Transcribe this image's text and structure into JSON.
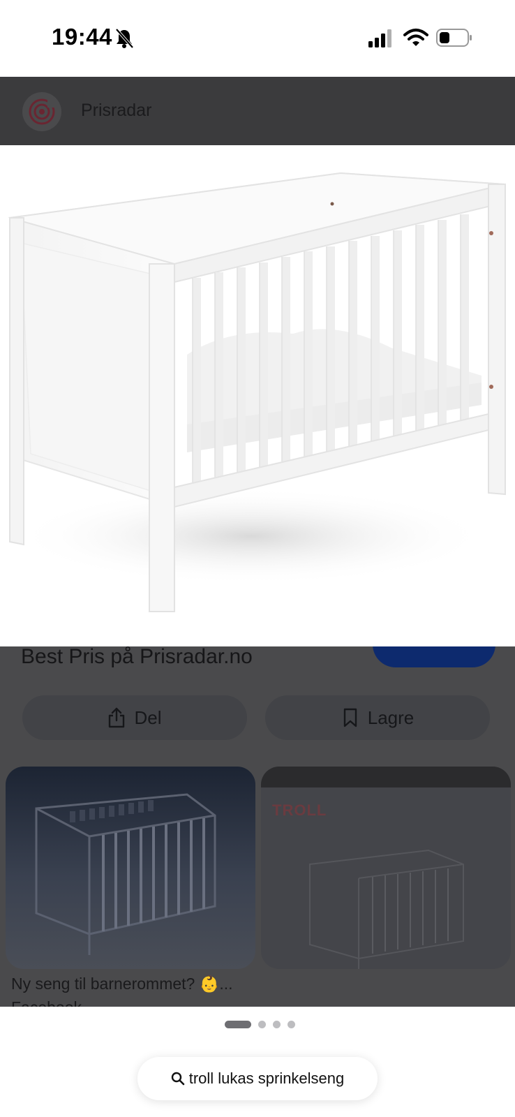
{
  "status_bar": {
    "time": "19:44",
    "icons": [
      "bell-slash-icon",
      "cellular-signal-icon",
      "wifi-icon",
      "battery-icon"
    ]
  },
  "background_page": {
    "site_name": "Prisradar",
    "site_logo_icon": "radar-icon",
    "title": "Best Pris på Prisradar.no",
    "share_button_label": "Del",
    "save_button_label": "Lagre",
    "results": [
      {
        "caption": "Ny seng til barnerommet? 👶...",
        "source": "Facebook"
      },
      {
        "caption": "",
        "source": "",
        "logo_text": "TROLL"
      }
    ]
  },
  "product_image": {
    "subject": "white crib"
  },
  "pagination": {
    "count": 4,
    "active_index": 0
  },
  "search": {
    "query": "troll lukas sprinkelseng",
    "icon": "search-icon"
  },
  "colors": {
    "overlay": "#4a4a4c",
    "header": "#3b3b3d",
    "accent_button": "#0d2a6e",
    "brand": "#b8283c"
  }
}
